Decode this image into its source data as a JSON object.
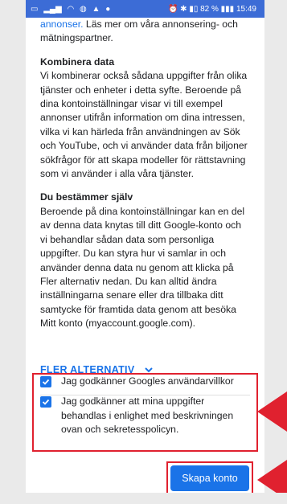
{
  "status": {
    "right": "⏰ ✱ ▮▯ 82 % ▮▮▮ 15:49"
  },
  "content": {
    "cut_line_link": "annonser.",
    "cut_line_link_rest": " Läs mer om våra annonsering- och",
    "cut_line_2": "mätningspartner.",
    "sections": [
      {
        "heading": "Kombinera data",
        "body": "Vi kombinerar också sådana uppgifter från olika tjänster och enheter i detta syfte. Beroende på dina kontoinställningar visar vi till exempel annonser utifrån information om dina intressen, vilka vi kan härleda från användningen av Sök och YouTube, och vi använder data från biljoner sökfrågor för att skapa modeller för rättstavning som vi använder i alla våra tjänster."
      },
      {
        "heading": "Du bestämmer själv",
        "body": "Beroende på dina kontoinställningar kan en del av denna data knytas till ditt Google-konto och vi behandlar sådan data som personliga uppgifter. Du kan styra hur vi samlar in och använder denna data nu genom att klicka på Fler alternativ nedan. Du kan alltid ändra inställningarna senare eller dra tillbaka ditt samtycke för framtida data genom att besöka Mitt konto (myaccount.google.com)."
      }
    ],
    "more_options": "FLER ALTERNATIV"
  },
  "consent": {
    "items": [
      {
        "label": "Jag godkänner Googles användarvillkor",
        "checked": true
      },
      {
        "label": "Jag godkänner att mina uppgifter behandlas i enlighet med beskrivningen ovan och sekretesspolicyn.",
        "checked": true
      }
    ]
  },
  "actions": {
    "create_account": "Skapa konto"
  },
  "colors": {
    "accent": "#1a73e8",
    "status_bar": "#3c6cd6",
    "annotation": "#e0212f"
  }
}
